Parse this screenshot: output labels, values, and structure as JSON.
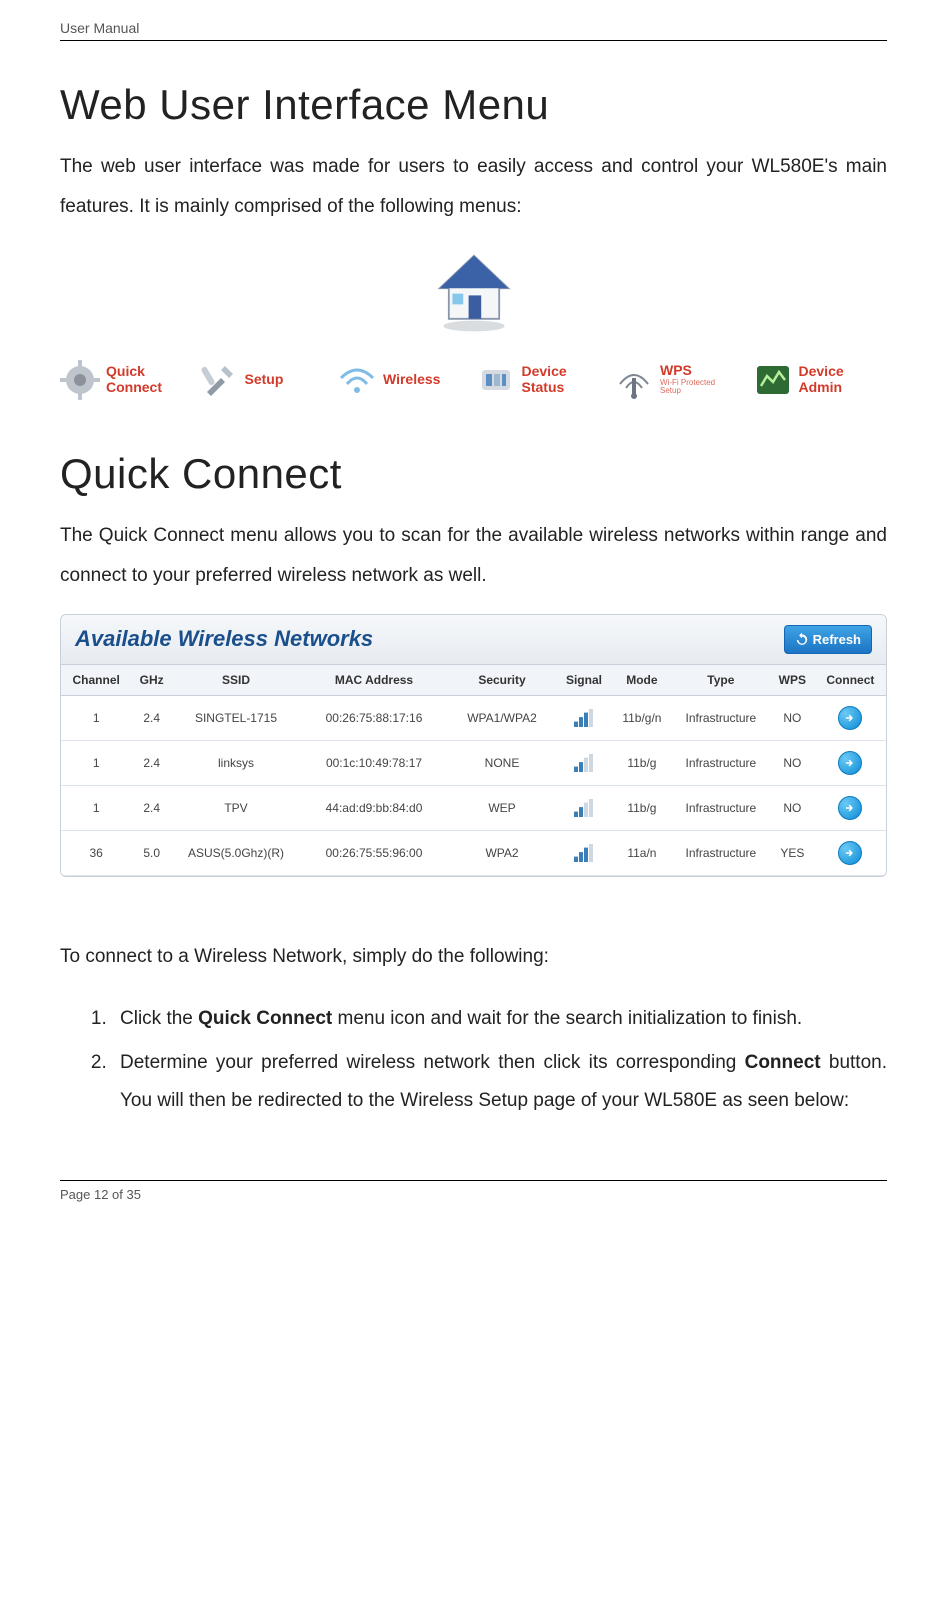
{
  "header": {
    "label": "User Manual"
  },
  "section1": {
    "title": "Web User Interface Menu",
    "para": "The web user interface was made for users to easily access and control your WL580E's main features. It is mainly comprised of the following menus:"
  },
  "menu": {
    "items": [
      {
        "label": "Quick\nConnect",
        "sub": ""
      },
      {
        "label": "Setup",
        "sub": ""
      },
      {
        "label": "Wireless",
        "sub": ""
      },
      {
        "label": "Device\nStatus",
        "sub": ""
      },
      {
        "label": "WPS",
        "sub": "Wi-Fi Protected\nSetup"
      },
      {
        "label": "Device\nAdmin",
        "sub": ""
      }
    ]
  },
  "section2": {
    "title": "Quick Connect",
    "para": "The Quick Connect menu allows you to scan for the available wireless networks within range and connect to your preferred wireless network as well."
  },
  "panel": {
    "title": "Available Wireless Networks",
    "refresh": "Refresh",
    "columns": [
      "Channel",
      "GHz",
      "SSID",
      "MAC Address",
      "Security",
      "Signal",
      "Mode",
      "Type",
      "WPS",
      "Connect"
    ]
  },
  "chart_data": {
    "type": "table",
    "columns": [
      "Channel",
      "GHz",
      "SSID",
      "MAC Address",
      "Security",
      "Signal",
      "Mode",
      "Type",
      "WPS"
    ],
    "rows": [
      {
        "channel": "1",
        "ghz": "2.4",
        "ssid": "SINGTEL-1715",
        "mac": "00:26:75:88:17:16",
        "security": "WPA1/WPA2",
        "signal": 3,
        "mode": "11b/g/n",
        "type": "Infrastructure",
        "wps": "NO"
      },
      {
        "channel": "1",
        "ghz": "2.4",
        "ssid": "linksys",
        "mac": "00:1c:10:49:78:17",
        "security": "NONE",
        "signal": 2,
        "mode": "11b/g",
        "type": "Infrastructure",
        "wps": "NO"
      },
      {
        "channel": "1",
        "ghz": "2.4",
        "ssid": "TPV",
        "mac": "44:ad:d9:bb:84:d0",
        "security": "WEP",
        "signal": 2,
        "mode": "11b/g",
        "type": "Infrastructure",
        "wps": "NO"
      },
      {
        "channel": "36",
        "ghz": "5.0",
        "ssid": "ASUS(5.0Ghz)(R)",
        "mac": "00:26:75:55:96:00",
        "security": "WPA2",
        "signal": 3,
        "mode": "11a/n",
        "type": "Infrastructure",
        "wps": "YES"
      }
    ]
  },
  "instructions": {
    "lead": "To connect to a Wireless Network, simply do the following:",
    "step1_a": "Click the ",
    "step1_bold": "Quick Connect",
    "step1_b": " menu icon and wait for the search initialization to finish.",
    "step2_a": "Determine your preferred wireless network then click its corresponding ",
    "step2_bold": "Connect",
    "step2_b": " button. You will then be redirected to the Wireless Setup page of your WL580E as seen below:"
  },
  "footer": {
    "page": "Page 12 of 35"
  }
}
